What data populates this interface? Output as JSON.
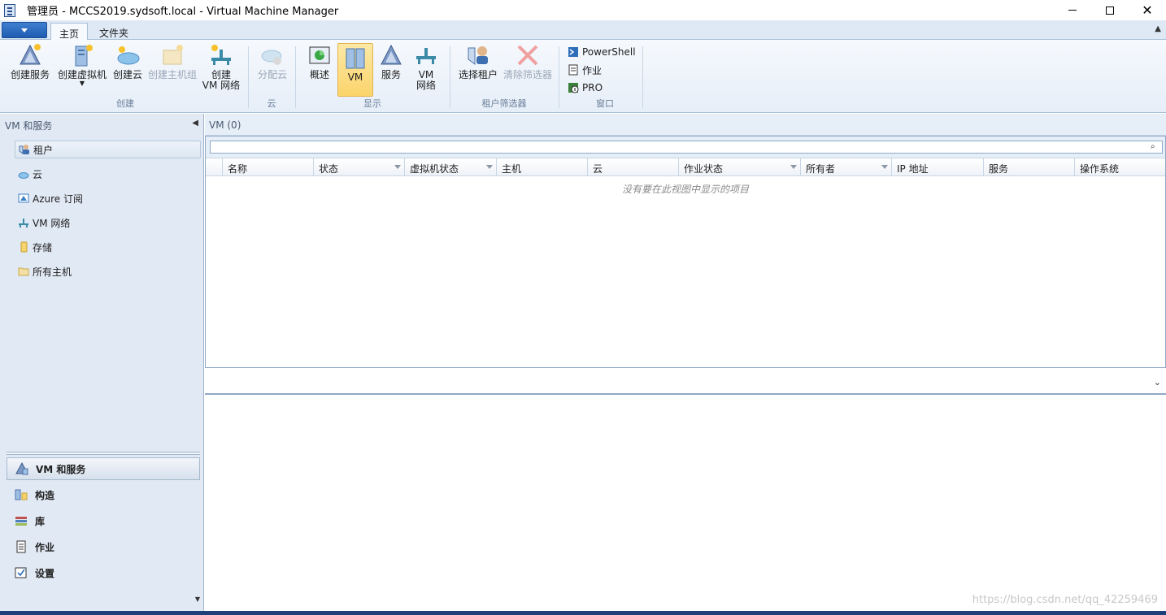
{
  "window": {
    "title": "管理员 - MCCS2019.sydsoft.local - Virtual Machine Manager"
  },
  "ribbon_tabs": [
    {
      "label": "主页",
      "active": true
    },
    {
      "label": "文件夹",
      "active": false
    }
  ],
  "ribbon": {
    "groups": [
      {
        "label": "创建",
        "buttons": [
          {
            "label": "创建服务",
            "icon": "create-service-icon"
          },
          {
            "label": "创建虚拟机",
            "icon": "create-vm-icon",
            "has_dropdown": true
          },
          {
            "label": "创建云",
            "icon": "create-cloud-icon"
          },
          {
            "label": "创建主机组",
            "icon": "create-host-group-icon",
            "disabled": true
          },
          {
            "label_line1": "创建",
            "label_line2": "VM 网络",
            "icon": "create-vm-network-icon"
          }
        ]
      },
      {
        "label": "云",
        "buttons": [
          {
            "label": "分配云",
            "icon": "assign-cloud-icon",
            "disabled": true
          }
        ]
      },
      {
        "label": "显示",
        "buttons": [
          {
            "label": "概述",
            "icon": "overview-icon"
          },
          {
            "label": "VM",
            "icon": "vm-icon",
            "selected": true
          },
          {
            "label": "服务",
            "icon": "services-icon"
          },
          {
            "label_line1": "VM",
            "label_line2": "网络",
            "icon": "vm-network-icon"
          }
        ]
      },
      {
        "label": "租户筛选器",
        "buttons": [
          {
            "label": "选择租户",
            "icon": "select-tenant-icon"
          },
          {
            "label": "清除筛选器",
            "icon": "clear-filter-icon",
            "disabled": true
          }
        ]
      },
      {
        "label": "窗口",
        "buttons": [
          {
            "label": "PowerShell",
            "icon": "powershell-icon"
          },
          {
            "label": "作业",
            "icon": "jobs-icon"
          },
          {
            "label": "PRO",
            "icon": "pro-icon"
          }
        ]
      }
    ]
  },
  "left_pane": {
    "header": "VM 和服务",
    "tree": [
      {
        "label": "租户",
        "icon": "tenant-icon",
        "selected": true
      },
      {
        "label": "云",
        "icon": "cloud-icon"
      },
      {
        "label": "Azure 订阅",
        "icon": "azure-subscription-icon"
      },
      {
        "label": "VM 网络",
        "icon": "vm-network-icon"
      },
      {
        "label": "存储",
        "icon": "storage-icon"
      },
      {
        "label": "所有主机",
        "icon": "folder-icon"
      }
    ],
    "workspaces": [
      {
        "label": "VM 和服务",
        "icon": "vms-services-icon",
        "selected": true
      },
      {
        "label": "构造",
        "icon": "fabric-icon"
      },
      {
        "label": "库",
        "icon": "library-icon"
      },
      {
        "label": "作业",
        "icon": "jobs-icon"
      },
      {
        "label": "设置",
        "icon": "settings-icon"
      }
    ]
  },
  "main": {
    "header": "VM (0)",
    "search": {
      "value": "",
      "placeholder": ""
    },
    "columns": [
      {
        "label": "",
        "dropdown": false
      },
      {
        "label": "名称",
        "dropdown": false
      },
      {
        "label": "状态",
        "dropdown": true
      },
      {
        "label": "虚拟机状态",
        "dropdown": true
      },
      {
        "label": "主机",
        "dropdown": false
      },
      {
        "label": "云",
        "dropdown": false
      },
      {
        "label": "作业状态",
        "dropdown": true
      },
      {
        "label": "所有者",
        "dropdown": true
      },
      {
        "label": "IP 地址",
        "dropdown": false
      },
      {
        "label": "服务",
        "dropdown": false
      },
      {
        "label": "操作系统",
        "dropdown": false
      }
    ],
    "empty_message": "没有要在此视图中显示的项目"
  },
  "watermark": "https://blog.csdn.net/qq_42259469",
  "colors": {
    "ribbon_bg": "#e6eef8",
    "selected_button": "#fbd46b",
    "border": "#8fa8c6",
    "status_bar": "#1d3f7a"
  }
}
